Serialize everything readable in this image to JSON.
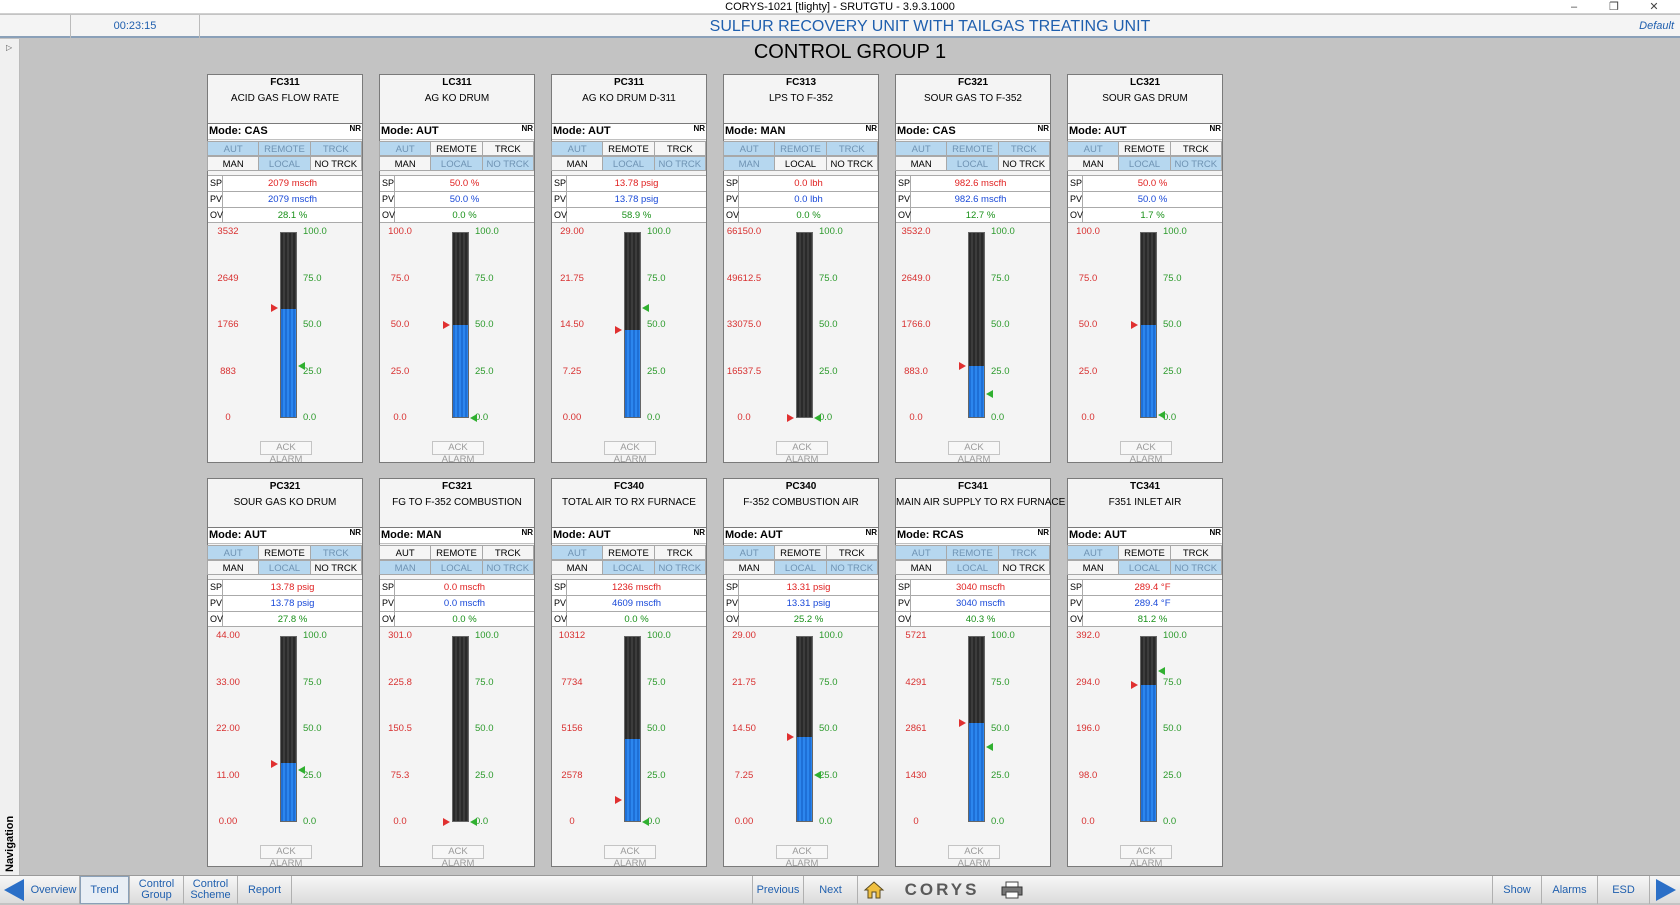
{
  "window": {
    "title": "CORYS-1021 [tlighty] - SRUTGTU - 3.9.3.1000"
  },
  "header": {
    "clock": "00:23:15",
    "title": "SULFUR RECOVERY UNIT WITH TAILGAS TREATING UNIT",
    "profile": "Default"
  },
  "leftnav": {
    "label": "Navigation"
  },
  "page": {
    "title": "CONTROL GROUP 1"
  },
  "ack_label": "ACK ALARM",
  "nr_label": "NR",
  "sp_label": "SP",
  "pv_label": "PV",
  "ov_label": "OV",
  "mode_buttons": {
    "aut": "AUT",
    "remote": "REMOTE",
    "trck": "TRCK",
    "man": "MAN",
    "local": "LOCAL",
    "notrck": "NO TRCK"
  },
  "panels": [
    {
      "tag": "FC311",
      "desc": "ACID GAS FLOW RATE",
      "mode": "Mode: CAS",
      "sel": [
        "aut",
        "remote",
        "trck",
        "local"
      ],
      "sp": "2079 mscfh",
      "pv": "2079 mscfh",
      "ov": "28.1 %",
      "left_ticks": [
        "3532",
        "2649",
        "1766",
        "883",
        "0"
      ],
      "right_ticks": [
        "100.0",
        "75.0",
        "50.0",
        "25.0",
        "0.0"
      ],
      "pv_frac": 0.589,
      "sp_frac": 0.589,
      "ov_frac": 0.281
    },
    {
      "tag": "LC311",
      "desc": "AG KO DRUM",
      "mode": "Mode: AUT",
      "sel": [
        "aut",
        "local",
        "notrck"
      ],
      "sp": "50.0 %",
      "pv": "50.0 %",
      "ov": "0.0 %",
      "left_ticks": [
        "100.0",
        "75.0",
        "50.0",
        "25.0",
        "0.0"
      ],
      "right_ticks": [
        "100.0",
        "75.0",
        "50.0",
        "25.0",
        "0.0"
      ],
      "pv_frac": 0.5,
      "sp_frac": 0.5,
      "ov_frac": 0.0
    },
    {
      "tag": "PC311",
      "desc": "AG KO DRUM D-311",
      "mode": "Mode: AUT",
      "sel": [
        "aut",
        "local",
        "notrck"
      ],
      "sp": "13.78 psig",
      "pv": "13.78 psig",
      "ov": "58.9 %",
      "left_ticks": [
        "29.00",
        "21.75",
        "14.50",
        "7.25",
        "0.00"
      ],
      "right_ticks": [
        "100.0",
        "75.0",
        "50.0",
        "25.0",
        "0.0"
      ],
      "pv_frac": 0.475,
      "sp_frac": 0.475,
      "ov_frac": 0.589
    },
    {
      "tag": "FC313",
      "desc": "LPS TO F-352",
      "mode": "Mode: MAN",
      "sel": [
        "aut",
        "remote",
        "trck",
        "man"
      ],
      "sp": "0.0 lbh",
      "pv": "0.0 lbh",
      "ov": "0.0 %",
      "left_ticks": [
        "66150.0",
        "49612.5",
        "33075.0",
        "16537.5",
        "0.0"
      ],
      "right_ticks": [
        "100.0",
        "75.0",
        "50.0",
        "25.0",
        "0.0"
      ],
      "pv_frac": 0.0,
      "sp_frac": 0.0,
      "ov_frac": 0.0
    },
    {
      "tag": "FC321",
      "desc": "SOUR GAS TO F-352",
      "mode": "Mode: CAS",
      "sel": [
        "aut",
        "remote",
        "trck",
        "local"
      ],
      "sp": "982.6 mscfh",
      "pv": "982.6 mscfh",
      "ov": "12.7 %",
      "left_ticks": [
        "3532.0",
        "2649.0",
        "1766.0",
        "883.0",
        "0.0"
      ],
      "right_ticks": [
        "100.0",
        "75.0",
        "50.0",
        "25.0",
        "0.0"
      ],
      "pv_frac": 0.278,
      "sp_frac": 0.278,
      "ov_frac": 0.127
    },
    {
      "tag": "LC321",
      "desc": "SOUR GAS DRUM",
      "mode": "Mode: AUT",
      "sel": [
        "aut",
        "local",
        "notrck"
      ],
      "sp": "50.0 %",
      "pv": "50.0 %",
      "ov": "1.7 %",
      "left_ticks": [
        "100.0",
        "75.0",
        "50.0",
        "25.0",
        "0.0"
      ],
      "right_ticks": [
        "100.0",
        "75.0",
        "50.0",
        "25.0",
        "0.0"
      ],
      "pv_frac": 0.5,
      "sp_frac": 0.5,
      "ov_frac": 0.017
    },
    {
      "tag": "PC321",
      "desc": "SOUR GAS KO DRUM",
      "mode": "Mode: AUT",
      "sel": [
        "aut",
        "trck",
        "local"
      ],
      "sp": "13.78 psig",
      "pv": "13.78 psig",
      "ov": "27.8 %",
      "left_ticks": [
        "44.00",
        "33.00",
        "22.00",
        "11.00",
        "0.00"
      ],
      "right_ticks": [
        "100.0",
        "75.0",
        "50.0",
        "25.0",
        "0.0"
      ],
      "pv_frac": 0.313,
      "sp_frac": 0.313,
      "ov_frac": 0.278
    },
    {
      "tag": "FC321",
      "desc": "FG TO F-352 COMBUSTION",
      "mode": "Mode: MAN",
      "sel": [
        "man",
        "local",
        "notrck"
      ],
      "sp": "0.0 mscfh",
      "pv": "0.0 mscfh",
      "ov": "0.0 %",
      "left_ticks": [
        "301.0",
        "225.8",
        "150.5",
        "75.3",
        "0.0"
      ],
      "right_ticks": [
        "100.0",
        "75.0",
        "50.0",
        "25.0",
        "0.0"
      ],
      "pv_frac": 0.0,
      "sp_frac": 0.0,
      "ov_frac": 0.0
    },
    {
      "tag": "FC340",
      "desc": "TOTAL AIR TO RX FURNACE",
      "mode": "Mode: AUT",
      "sel": [
        "aut",
        "local",
        "notrck"
      ],
      "sp": "1236 mscfh",
      "pv": "4609 mscfh",
      "ov": "0.0 %",
      "left_ticks": [
        "10312",
        "7734",
        "5156",
        "2578",
        "0"
      ],
      "right_ticks": [
        "100.0",
        "75.0",
        "50.0",
        "25.0",
        "0.0"
      ],
      "pv_frac": 0.447,
      "sp_frac": 0.12,
      "ov_frac": 0.0
    },
    {
      "tag": "PC340",
      "desc": "F-352 COMBUSTION AIR",
      "mode": "Mode: AUT",
      "sel": [
        "aut",
        "local",
        "notrck"
      ],
      "sp": "13.31 psig",
      "pv": "13.31 psig",
      "ov": "25.2 %",
      "left_ticks": [
        "29.00",
        "21.75",
        "14.50",
        "7.25",
        "0.00"
      ],
      "right_ticks": [
        "100.0",
        "75.0",
        "50.0",
        "25.0",
        "0.0"
      ],
      "pv_frac": 0.459,
      "sp_frac": 0.459,
      "ov_frac": 0.252
    },
    {
      "tag": "FC341",
      "desc": "MAIN AIR SUPPLY TO RX FURNACE",
      "mode": "Mode: RCAS",
      "sel": [
        "aut",
        "remote",
        "trck",
        "local"
      ],
      "sp": "3040 mscfh",
      "pv": "3040 mscfh",
      "ov": "40.3 %",
      "left_ticks": [
        "5721",
        "4291",
        "2861",
        "1430",
        "0"
      ],
      "right_ticks": [
        "100.0",
        "75.0",
        "50.0",
        "25.0",
        "0.0"
      ],
      "pv_frac": 0.531,
      "sp_frac": 0.531,
      "ov_frac": 0.403
    },
    {
      "tag": "TC341",
      "desc": "F351 INLET AIR",
      "mode": "Mode: AUT",
      "sel": [
        "aut",
        "local",
        "notrck"
      ],
      "sp": "289.4 °F",
      "pv": "289.4 °F",
      "ov": "81.2 %",
      "left_ticks": [
        "392.0",
        "294.0",
        "196.0",
        "98.0",
        "0.0"
      ],
      "right_ticks": [
        "100.0",
        "75.0",
        "50.0",
        "25.0",
        "0.0"
      ],
      "pv_frac": 0.738,
      "sp_frac": 0.738,
      "ov_frac": 0.812
    }
  ],
  "bottom": {
    "overview": "Overview",
    "trend": "Trend",
    "control_group": "Control Group",
    "control_scheme": "Control Scheme",
    "report": "Report",
    "previous": "Previous",
    "next": "Next",
    "logo": "CORYS",
    "show": "Show",
    "alarms": "Alarms",
    "esd": "ESD"
  },
  "colors": {
    "accent": "#1f5fae",
    "sp": "#e02020",
    "pv": "#1848d8",
    "ov": "#189018",
    "fill": "#2c86ee"
  }
}
